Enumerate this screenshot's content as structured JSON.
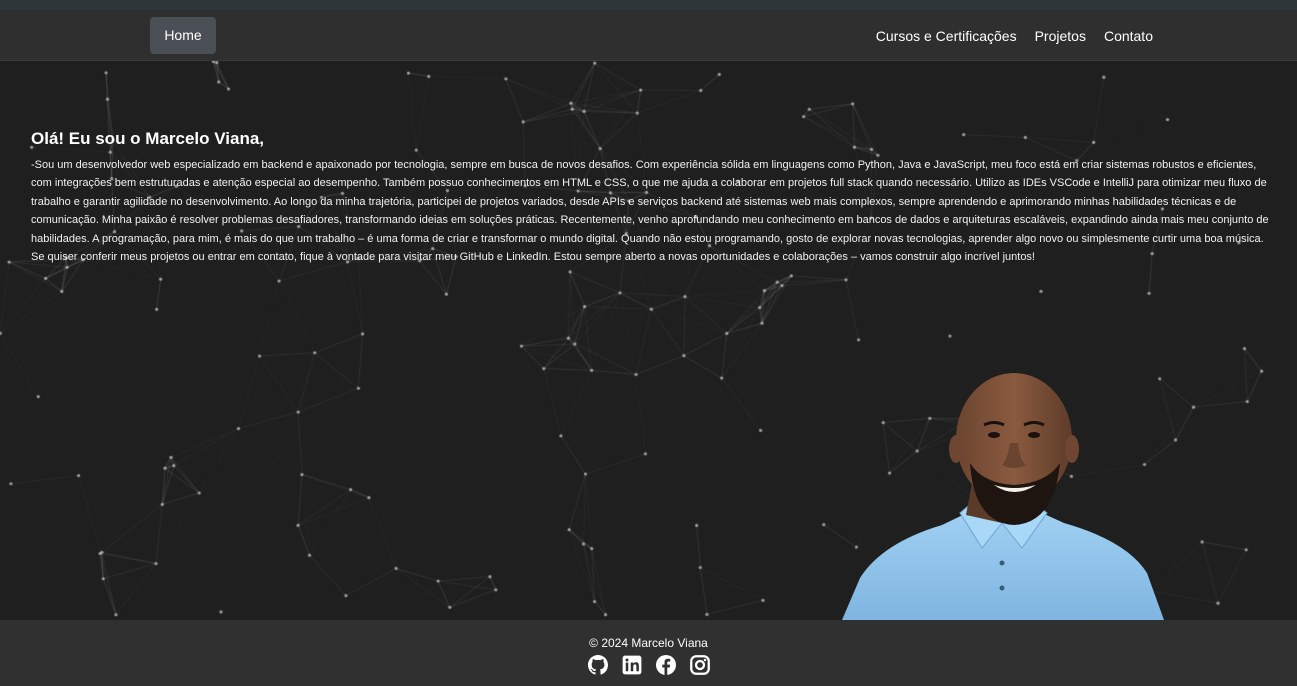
{
  "nav": {
    "home": "Home",
    "links": [
      "Cursos e Certificações",
      "Projetos",
      "Contato"
    ]
  },
  "hero": {
    "title": "Olá! Eu sou o Marcelo Viana,",
    "bio": "-Sou um desenvolvedor web especializado em backend e apaixonado por tecnologia, sempre em busca de novos desafios. Com experiência sólida em linguagens como Python, Java e JavaScript, meu foco está em criar sistemas robustos e eficientes, com integrações bem estruturadas e atenção especial ao desempenho. Também possuo conhecimentos em HTML e CSS, o que me ajuda a colaborar em projetos full stack quando necessário. Utilizo as IDEs VSCode e IntelliJ para otimizar meu fluxo de trabalho e garantir agilidade no desenvolvimento. Ao longo da minha trajetória, participei de projetos variados, desde APIs e serviços backend até sistemas web mais complexos, sempre aprendendo e aprimorando minhas habilidades técnicas e de comunicação. Minha paixão é resolver problemas desafiadores, transformando ideias em soluções práticas. Recentemente, venho aprofundando meu conhecimento em bancos de dados e arquiteturas escaláveis, expandindo ainda mais meu conjunto de habilidades. A programação, para mim, é mais do que um trabalho – é uma forma de criar e transformar o mundo digital. Quando não estou programando, gosto de explorar novas tecnologias, aprender algo novo ou simplesmente curtir uma boa música. Se quiser conferir meus projetos ou entrar em contato, fique à vontade para visitar meu GitHub e LinkedIn. Estou sempre aberto a novas oportunidades e colaborações – vamos construir algo incrível juntos!"
  },
  "footer": {
    "copyright": "© 2024 Marcelo Viana",
    "social_icons": [
      "github-icon",
      "linkedin-icon",
      "facebook-icon",
      "instagram-icon"
    ]
  },
  "colors": {
    "background": "#1f1f1f",
    "navbar": "#2f2f2f",
    "home_button": "#4a4e55",
    "footer": "#303030",
    "shirt": "#8ec3ea"
  }
}
